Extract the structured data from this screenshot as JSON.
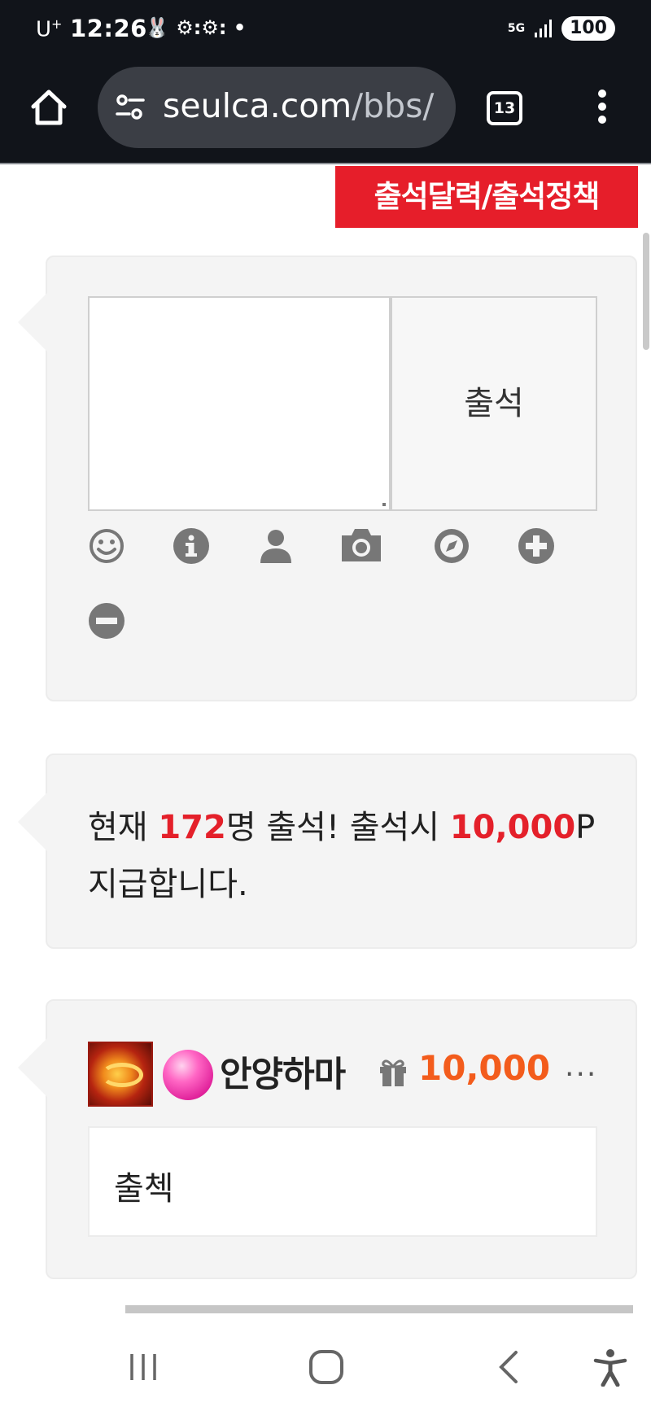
{
  "status_bar": {
    "carrier": "U",
    "carrier_sup": "+",
    "time": "12:26",
    "indicators": "🐰 ⚙:⚙: •",
    "network": "5G",
    "battery": "100"
  },
  "browser": {
    "url_domain": "seulca.com",
    "url_path": "/bbs/",
    "tab_count": "13",
    "icons": [
      "home-icon",
      "tune-icon",
      "tabs-icon",
      "more-vert-icon"
    ]
  },
  "page": {
    "banner_label": "출석달력/출석정책",
    "banner_color": "#e61e2a",
    "composer": {
      "textarea_value": "",
      "submit_label": "출석",
      "toolbar_icons": [
        "emoji-icon",
        "info-icon",
        "user-icon",
        "camera-icon",
        "compass-icon",
        "plus-circle-icon",
        "minus-circle-icon"
      ]
    },
    "notice": {
      "prefix": "현재 ",
      "count": "172",
      "middle": "명 출석! 출석시 ",
      "points": "10,000",
      "suffix": "P 지급합니다.",
      "highlight_color": "#e4202a"
    },
    "comment": {
      "nickname": "안양하마",
      "points": "10,000",
      "points_color": "#f35c1c",
      "more": "...",
      "body": "출첵"
    }
  },
  "nav_bar": {
    "icons": [
      "recent-apps-icon",
      "home-nav-icon",
      "back-icon",
      "accessibility-icon"
    ]
  }
}
